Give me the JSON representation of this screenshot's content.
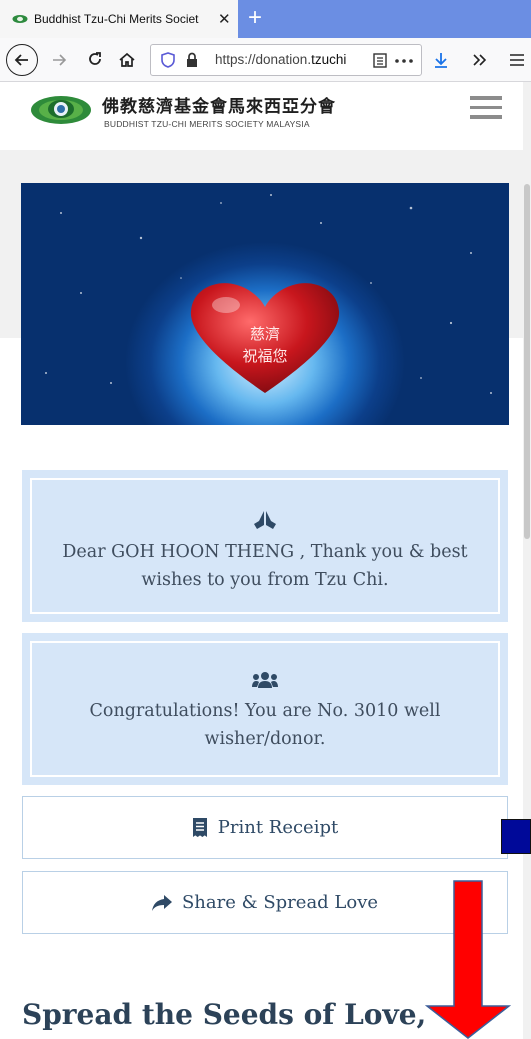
{
  "browser": {
    "tab_title": "Buddhist Tzu-Chi Merits Societ",
    "new_tab_glyph": "+",
    "close_glyph": "✕",
    "url_prefix": "https://donation.",
    "url_domain": "tzuchi"
  },
  "header": {
    "logo_cn": "佛教慈濟基金會馬來西亞分會",
    "logo_en": "BUDDHIST TZU-CHI MERITS SOCIETY MALAYSIA"
  },
  "banner": {
    "heart_line1": "慈濟",
    "heart_line2": "祝福您"
  },
  "messages": {
    "thanks_text": "Dear GOH HOON THENG , Thank you & best wishes to you from Tzu Chi.",
    "donor_text": "Congratulations! You are No. 3010 well wisher/donor."
  },
  "actions": {
    "print_label": "Print Receipt",
    "share_label": "Share & Spread Love"
  },
  "section": {
    "title": "Spread the Seeds of Love,"
  },
  "colors": {
    "tab_strip": "#6b8ee3",
    "card_bg": "#d6e6f8",
    "text_dark": "#2c4258",
    "annotation_arrow": "#ff0000",
    "annotation_square": "#000999"
  }
}
